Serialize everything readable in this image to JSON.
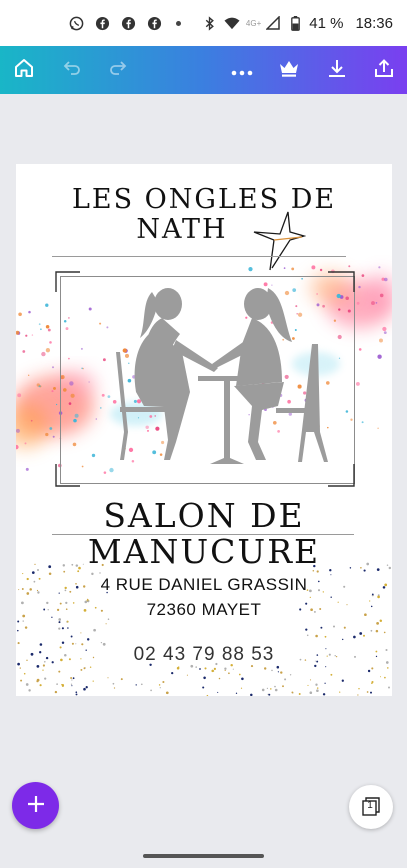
{
  "status_bar": {
    "icons": [
      "whatsapp-icon",
      "facebook-icon",
      "facebook-icon",
      "facebook-icon",
      "more-dot-icon",
      "bluetooth-icon",
      "wifi-icon",
      "signal-icon",
      "battery-icon"
    ],
    "network": "4G+",
    "battery": "41 %",
    "time": "18:36"
  },
  "toolbar": {
    "icons": [
      "home-icon",
      "undo-icon",
      "redo-icon",
      "more-icon",
      "crown-icon",
      "download-icon",
      "share-icon"
    ]
  },
  "design": {
    "title_line1": "LES ONGLES DE",
    "title_line2": "NATH",
    "heading_line1": "SALON DE",
    "heading_line2": "MANUCURE",
    "address_line1": "4 RUE DANIEL GRASSIN",
    "address_line2": "72360 MAYET",
    "phone": "02 43 79 88 53"
  },
  "bottom": {
    "add_icon": "plus-icon",
    "pages_icon": "pages-icon",
    "page_count": "1"
  },
  "colors": {
    "toolbar_start": "#19b6c7",
    "toolbar_end": "#7a3ff0",
    "fab": "#7d2ae8"
  }
}
